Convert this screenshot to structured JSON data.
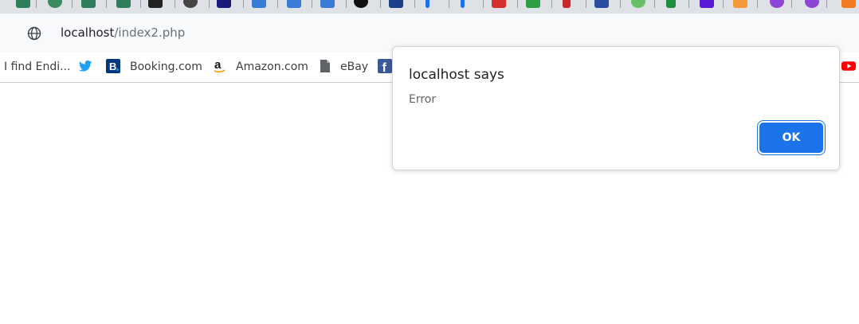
{
  "browser": {
    "address_bar": {
      "host": "localhost",
      "path": "/index2.php",
      "icon": "globe-icon"
    },
    "bookmarks": [
      {
        "label": "I find Endi...",
        "icon": "none"
      },
      {
        "label": "",
        "icon": "twitter-icon"
      },
      {
        "label": "Booking.com",
        "icon": "booking-icon"
      },
      {
        "label": "Amazon.com",
        "icon": "amazon-icon"
      },
      {
        "label": "eBay",
        "icon": "file-icon"
      },
      {
        "label": "",
        "icon": "facebook-icon"
      },
      {
        "label": "",
        "icon": "youtube-icon"
      }
    ]
  },
  "dialog": {
    "title": "localhost says",
    "message": "Error",
    "ok_label": "OK"
  },
  "colors": {
    "accent": "#1a73e8",
    "tabstrip": "#dee1e6",
    "toolbar": "#f8f9fb"
  }
}
